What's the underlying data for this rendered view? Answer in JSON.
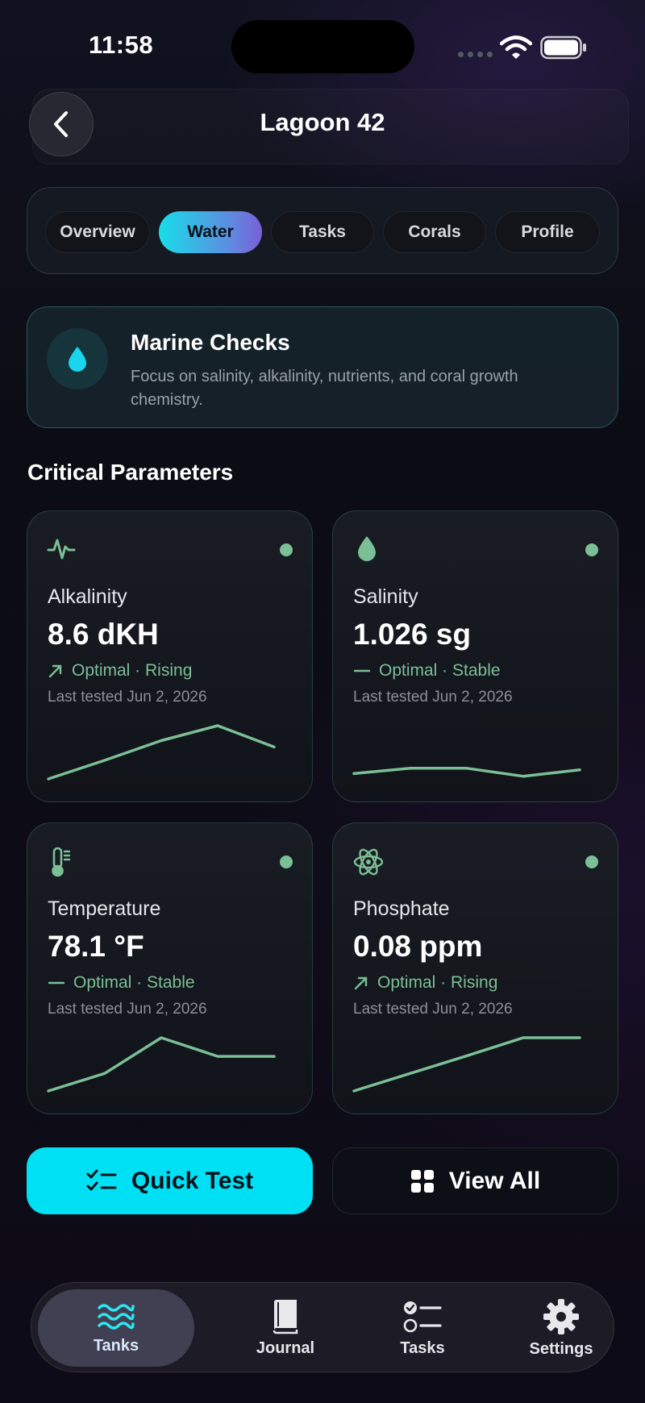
{
  "status_bar": {
    "time": "11:58"
  },
  "header": {
    "title": "Lagoon 42"
  },
  "tabs": [
    {
      "label": "Overview",
      "active": false
    },
    {
      "label": "Water",
      "active": true
    },
    {
      "label": "Tasks",
      "active": false
    },
    {
      "label": "Corals",
      "active": false
    },
    {
      "label": "Profile",
      "active": false
    }
  ],
  "info_card": {
    "icon": "water-drop-icon",
    "title": "Marine Checks",
    "description": "Focus on salinity, alkalinity, nutrients, and coral growth chemistry."
  },
  "section": {
    "title": "Critical Parameters"
  },
  "parameters": [
    {
      "icon": "pulse-icon",
      "name": "Alkalinity",
      "value": "8.6 dKH",
      "trend_icon": "arrow-up-right-icon",
      "trend": "Optimal · Rising",
      "tested": "Last tested Jun 2, 2026",
      "spark": [
        0,
        0.35,
        0.72,
        1.0,
        0.6
      ]
    },
    {
      "icon": "water-drop-icon",
      "name": "Salinity",
      "value": "1.026 sg",
      "trend_icon": "dash-icon",
      "trend": "Optimal · Stable",
      "tested": "Last tested Jun 2, 2026",
      "spark": [
        0.1,
        0.2,
        0.2,
        0.05,
        0.17
      ]
    },
    {
      "icon": "thermometer-icon",
      "name": "Temperature",
      "value": "78.1 °F",
      "trend_icon": "dash-icon",
      "trend": "Optimal · Stable",
      "tested": "Last tested Jun 2, 2026",
      "spark": [
        0,
        0.33,
        1.0,
        0.65,
        0.65
      ]
    },
    {
      "icon": "atom-icon",
      "name": "Phosphate",
      "value": "0.08 ppm",
      "trend_icon": "arrow-up-right-icon",
      "trend": "Optimal · Rising",
      "tested": "Last tested Jun 2, 2026",
      "spark": [
        0,
        0.33,
        0.66,
        1.0,
        1.0
      ]
    }
  ],
  "actions": {
    "quick_test": "Quick Test",
    "view_all": "View All"
  },
  "tabbar": [
    {
      "label": "Tanks",
      "icon": "waves-icon",
      "active": true
    },
    {
      "label": "Journal",
      "icon": "book-icon",
      "active": false
    },
    {
      "label": "Tasks",
      "icon": "checklist-icon",
      "active": false
    },
    {
      "label": "Settings",
      "icon": "gear-icon",
      "active": false
    }
  ],
  "colors": {
    "accent": "#00e0f4",
    "status_green": "#7bbf96",
    "tab_active_start": "#19dde9",
    "tab_active_end": "#7a5fd8"
  }
}
